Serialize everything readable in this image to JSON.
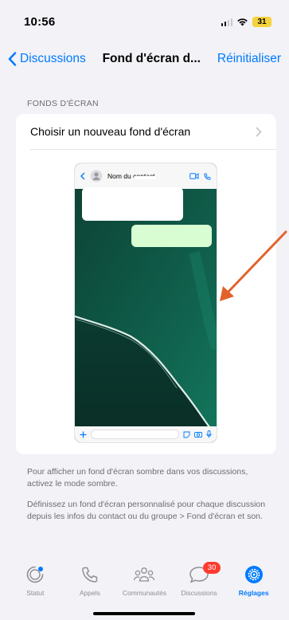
{
  "status_bar": {
    "time": "10:56",
    "battery": "31"
  },
  "nav": {
    "back_label": "Discussions",
    "title": "Fond d'écran d...",
    "action_label": "Réinitialiser"
  },
  "section": {
    "header": "FONDS D'ÉCRAN"
  },
  "card": {
    "row_label": "Choisir un nouveau fond d'écran",
    "preview": {
      "contact_name": "Nom du contact"
    }
  },
  "footer": {
    "paragraph1": "Pour afficher un fond d'écran sombre dans vos discussions, activez le mode sombre.",
    "paragraph2": "Définissez un fond d'écran personnalisé pour chaque discussion depuis les infos du contact ou du groupe > Fond d'écran et son."
  },
  "tabs": [
    {
      "label": "Statut",
      "icon": "status-icon"
    },
    {
      "label": "Appels",
      "icon": "phone-icon"
    },
    {
      "label": "Communautés",
      "icon": "communities-icon"
    },
    {
      "label": "Discussions",
      "icon": "chat-bubble-icon",
      "badge": "30"
    },
    {
      "label": "Réglages",
      "icon": "settings-gear-icon",
      "active": true
    }
  ],
  "colors": {
    "accent": "#007aff",
    "badge": "#ff3b30",
    "annotation_arrow": "#e2622b",
    "wallpaper": "#0e4a3c"
  }
}
